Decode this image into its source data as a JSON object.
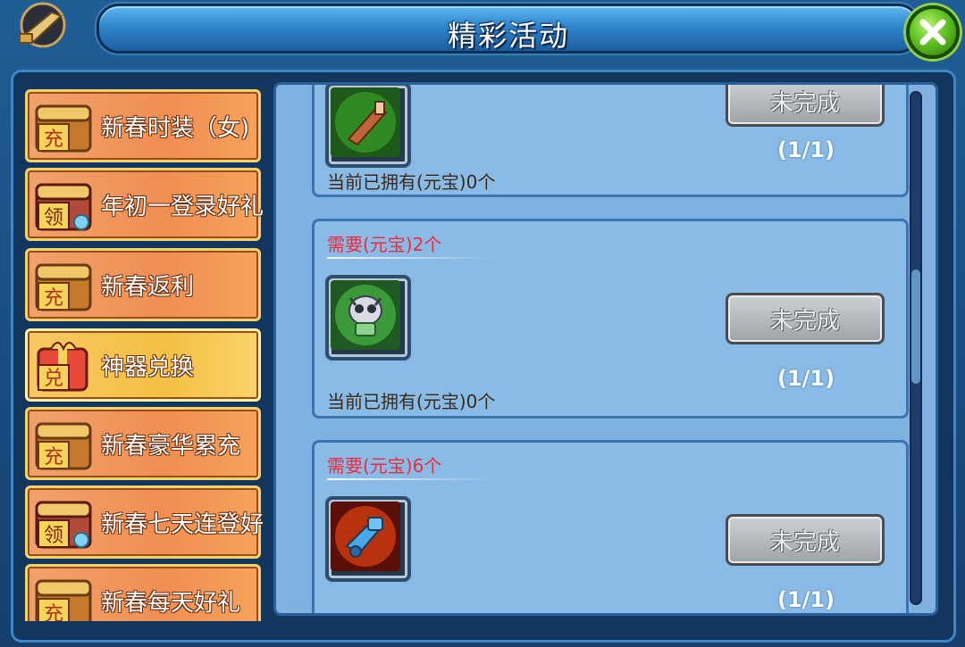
{
  "window": {
    "title": "精彩活动",
    "close_icon": "close-x-icon"
  },
  "sidebar": {
    "items": [
      {
        "label": "新春时装（女)",
        "badge": "充",
        "icon": "recharge-chest-icon",
        "selected": false
      },
      {
        "label": "年初一登录好礼",
        "badge": "领",
        "icon": "claim-gift-chest-icon",
        "selected": false
      },
      {
        "label": "新春返利",
        "badge": "充",
        "icon": "recharge-chest-icon",
        "selected": false
      },
      {
        "label": "神器兑换",
        "badge": "兑",
        "icon": "exchange-gift-icon",
        "selected": true
      },
      {
        "label": "新春豪华累充",
        "badge": "充",
        "icon": "recharge-chest-icon",
        "selected": false
      },
      {
        "label": "新春七天连登好礼",
        "badge": "领",
        "icon": "claim-gift-chest-icon",
        "selected": false
      },
      {
        "label": "新春每天好礼",
        "badge": "充",
        "icon": "recharge-chest-icon",
        "selected": false
      }
    ]
  },
  "cards": [
    {
      "requirement": "",
      "item_icon": "green-blade-icon",
      "status": "未完成",
      "progress": "(1/1)",
      "owned": "当前已拥有(元宝)0个"
    },
    {
      "requirement": "需要(元宝)2个",
      "item_icon": "owl-robot-icon",
      "status": "未完成",
      "progress": "(1/1)",
      "owned": "当前已拥有(元宝)0个"
    },
    {
      "requirement": "需要(元宝)6个",
      "item_icon": "blue-mech-icon",
      "status": "未完成",
      "progress": "(1/1)",
      "owned": ""
    }
  ],
  "colors": {
    "requirement_text": "#ee2b3c",
    "panel_bg": "#7fb2e0",
    "sidebar_selected": "#f4c043"
  }
}
